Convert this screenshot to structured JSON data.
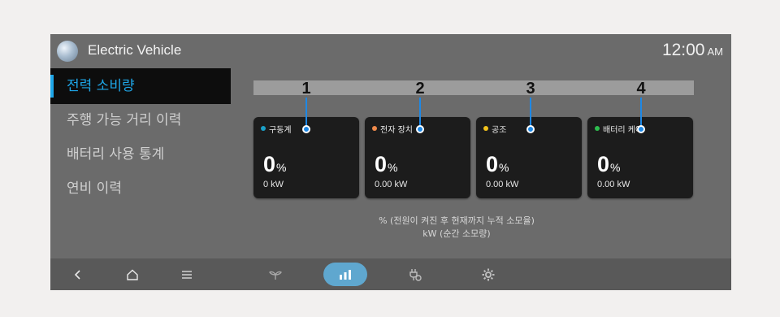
{
  "header": {
    "app_title": "Electric Vehicle",
    "time": "12:00",
    "ampm": "AM"
  },
  "sidebar": {
    "items": [
      {
        "label": "전력 소비량",
        "active": true
      },
      {
        "label": "주행 가능 거리 이력",
        "active": false
      },
      {
        "label": "배터리 사용 통계",
        "active": false
      },
      {
        "label": "연비 이력",
        "active": false
      }
    ]
  },
  "consumption_bar": {
    "fill_fraction": 0
  },
  "cards": [
    {
      "label": "구동계",
      "percent": "0",
      "percent_unit": "%",
      "kw": "0 kW",
      "dot_color": "#1aa0c8"
    },
    {
      "label": "전자 장치",
      "percent": "0",
      "percent_unit": "%",
      "kw": "0.00 kW",
      "dot_color": "#f08a4b"
    },
    {
      "label": "공조",
      "percent": "0",
      "percent_unit": "%",
      "kw": "0.00 kW",
      "dot_color": "#f2c21b"
    },
    {
      "label": "배터리 케어",
      "percent": "0",
      "percent_unit": "%",
      "kw": "0.00 kW",
      "dot_color": "#2ebd4f"
    }
  ],
  "callouts": [
    "1",
    "2",
    "3",
    "4"
  ],
  "footnote": {
    "line1": "% (전원이 켜진 후 현재까지 누적 소모율)",
    "line2": "kW (순간 소모량)"
  },
  "bottom_nav": {
    "items": [
      {
        "icon": "back-icon",
        "active": false
      },
      {
        "icon": "home-icon",
        "active": false
      },
      {
        "icon": "menu-icon",
        "active": false
      },
      {
        "icon": "eco-sprout-icon",
        "active": false
      },
      {
        "icon": "bar-chart-icon",
        "active": true
      },
      {
        "icon": "plug-settings-icon",
        "active": false
      },
      {
        "icon": "gear-icon",
        "active": false
      }
    ]
  },
  "colors": {
    "accent": "#1ea6e8",
    "callout": "#1e88e5"
  }
}
